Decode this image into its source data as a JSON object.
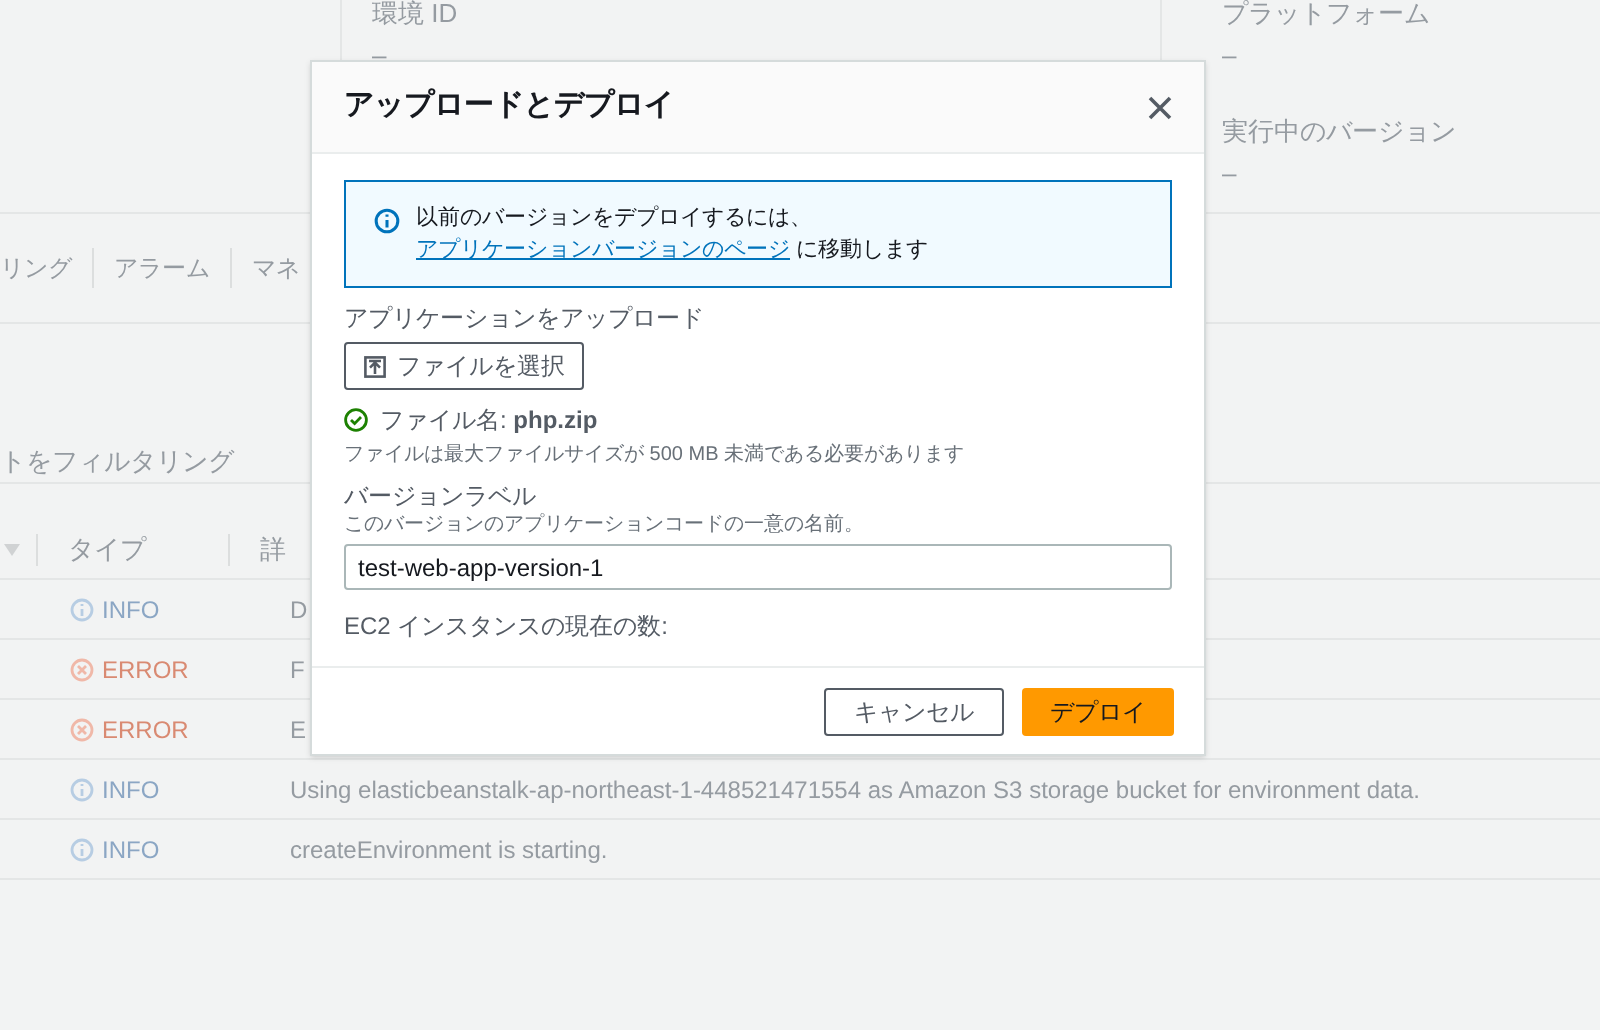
{
  "background": {
    "environment_id": {
      "label": "環境 ID",
      "value": "–"
    },
    "platform": {
      "label": "プラットフォーム",
      "value": "–"
    },
    "running_version": {
      "label": "実行中のバージョン",
      "value": "–"
    },
    "tabs": [
      {
        "label": "リング"
      },
      {
        "label": "アラーム"
      },
      {
        "label": "マネ"
      }
    ],
    "filter": {
      "placeholder": "トをフィルタリング"
    },
    "table": {
      "columns": [
        "タイプ",
        "詳"
      ],
      "rows": [
        {
          "kind": "info",
          "type": "INFO",
          "details": "D"
        },
        {
          "kind": "error",
          "type": "ERROR",
          "details": "F"
        },
        {
          "kind": "error",
          "type": "ERROR",
          "details": "E"
        },
        {
          "kind": "info",
          "type": "INFO",
          "details": "Using elasticbeanstalk-ap-northeast-1-448521471554 as Amazon S3 storage bucket for environment data."
        },
        {
          "kind": "info",
          "type": "INFO",
          "details": "createEnvironment is starting."
        }
      ]
    }
  },
  "dialog": {
    "title": "アップロードとデプロイ",
    "alert": {
      "text": "以前のバージョンをデプロイするには、",
      "link": "アプリケーションバージョンのページ",
      "text_after": "に移動します"
    },
    "upload": {
      "label": "アプリケーションをアップロード",
      "button": "ファイルを選択",
      "status": "ファイル名: **php.zip**",
      "hint": "ファイルは最大ファイルサイズが 500 MB 未満である必要があります"
    },
    "version_label": {
      "label": "バージョンラベル",
      "description": "このバージョンのアプリケーションコードの一意の名前。",
      "value": "test-web-app-version-1"
    },
    "instances": {
      "label": "EC2 インスタンスの現在の数:"
    },
    "buttons": [
      {
        "kind": "secondary",
        "label": "キャンセル"
      },
      {
        "kind": "primary",
        "label": "デプロイ"
      }
    ]
  }
}
